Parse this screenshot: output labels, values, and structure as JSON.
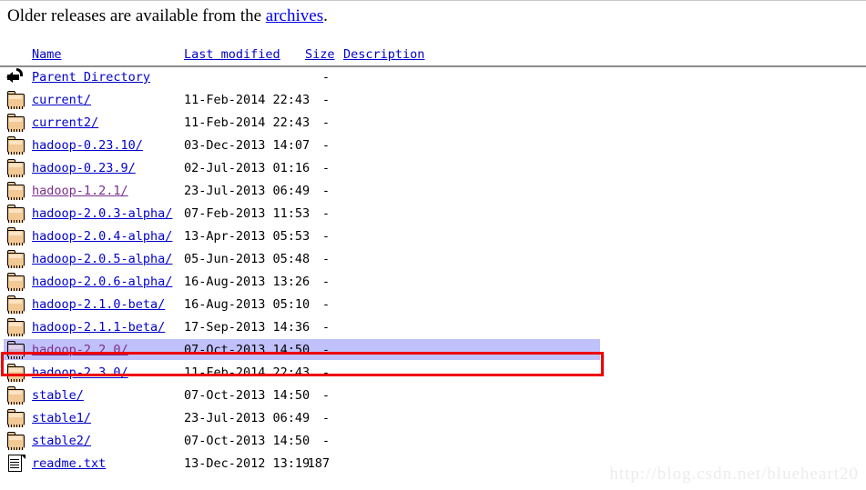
{
  "intro": {
    "text_before": "Older releases are available from the ",
    "link_label": "archives",
    "text_after": "."
  },
  "table": {
    "headers": {
      "name": "Name",
      "last_modified": "Last modified",
      "size": "Size",
      "description": "Description"
    },
    "rows": [
      {
        "icon": "back-arrow-icon",
        "name": "Parent Directory",
        "last_modified": "",
        "size": "-",
        "visited": false,
        "selected": false
      },
      {
        "icon": "folder-icon",
        "name": "current/",
        "last_modified": "11-Feb-2014 22:43",
        "size": "-",
        "visited": false,
        "selected": false
      },
      {
        "icon": "folder-icon",
        "name": "current2/",
        "last_modified": "11-Feb-2014 22:43",
        "size": "-",
        "visited": false,
        "selected": false
      },
      {
        "icon": "folder-icon",
        "name": "hadoop-0.23.10/",
        "last_modified": "03-Dec-2013 14:07",
        "size": "-",
        "visited": false,
        "selected": false
      },
      {
        "icon": "folder-icon",
        "name": "hadoop-0.23.9/",
        "last_modified": "02-Jul-2013 01:16",
        "size": "-",
        "visited": false,
        "selected": false
      },
      {
        "icon": "folder-icon",
        "name": "hadoop-1.2.1/",
        "last_modified": "23-Jul-2013 06:49",
        "size": "-",
        "visited": true,
        "selected": false
      },
      {
        "icon": "folder-icon",
        "name": "hadoop-2.0.3-alpha/",
        "last_modified": "07-Feb-2013 11:53",
        "size": "-",
        "visited": false,
        "selected": false
      },
      {
        "icon": "folder-icon",
        "name": "hadoop-2.0.4-alpha/",
        "last_modified": "13-Apr-2013 05:53",
        "size": "-",
        "visited": false,
        "selected": false
      },
      {
        "icon": "folder-icon",
        "name": "hadoop-2.0.5-alpha/",
        "last_modified": "05-Jun-2013 05:48",
        "size": "-",
        "visited": false,
        "selected": false
      },
      {
        "icon": "folder-icon",
        "name": "hadoop-2.0.6-alpha/",
        "last_modified": "16-Aug-2013 13:26",
        "size": "-",
        "visited": false,
        "selected": false
      },
      {
        "icon": "folder-icon",
        "name": "hadoop-2.1.0-beta/",
        "last_modified": "16-Aug-2013 05:10",
        "size": "-",
        "visited": false,
        "selected": false
      },
      {
        "icon": "folder-icon",
        "name": "hadoop-2.1.1-beta/",
        "last_modified": "17-Sep-2013 14:36",
        "size": "-",
        "visited": false,
        "selected": false
      },
      {
        "icon": "folder-icon",
        "name": "hadoop-2.2.0/",
        "last_modified": "07-Oct-2013 14:50",
        "size": "-",
        "visited": true,
        "selected": true
      },
      {
        "icon": "folder-icon",
        "name": "hadoop-2.3.0/",
        "last_modified": "11-Feb-2014 22:43",
        "size": "-",
        "visited": false,
        "selected": false
      },
      {
        "icon": "folder-icon",
        "name": "stable/",
        "last_modified": "07-Oct-2013 14:50",
        "size": "-",
        "visited": false,
        "selected": false
      },
      {
        "icon": "folder-icon",
        "name": "stable1/",
        "last_modified": "23-Jul-2013 06:49",
        "size": "-",
        "visited": false,
        "selected": false
      },
      {
        "icon": "folder-icon",
        "name": "stable2/",
        "last_modified": "07-Oct-2013 14:50",
        "size": "-",
        "visited": false,
        "selected": false
      },
      {
        "icon": "text-file-icon",
        "name": "readme.txt",
        "last_modified": "13-Dec-2012 13:19",
        "size": "187",
        "visited": false,
        "selected": false
      }
    ]
  },
  "annotation": {
    "highlight_color": "#ee0000",
    "selection_color": "#c0c0fa",
    "highlighted_row_name": "hadoop-2.2.0/"
  },
  "watermark": {
    "text": "http://blog.csdn.net/blueheart20"
  }
}
